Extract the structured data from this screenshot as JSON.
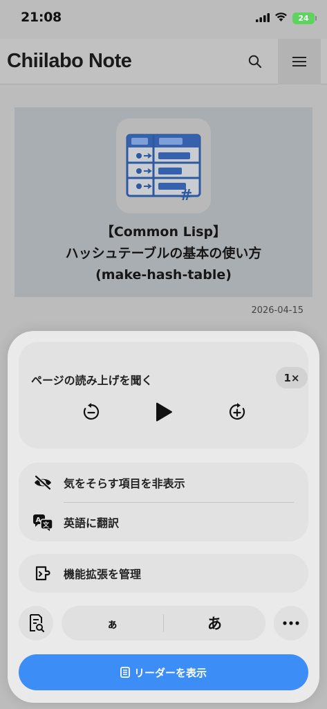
{
  "status": {
    "time": "21:08",
    "battery": "24"
  },
  "header": {
    "title": "Chiilabo Note"
  },
  "article": {
    "title_line1": "【Common Lisp】",
    "title_line2": "ハッシュテーブルの基本の使い方",
    "title_line3": "(make-hash-table)",
    "date": "2026-04-15"
  },
  "sheet": {
    "listen_title": "ページの読み上げを聞く",
    "speed": "1×",
    "hide_distractions": "気をそらす項目を非表示",
    "translate": "英語に翻訳",
    "manage_extensions": "機能拡張を管理",
    "font_small": "ぁ",
    "font_large": "あ",
    "reader_label": "リーダーを表示"
  },
  "colors": {
    "accent": "#3c8df5",
    "battery": "#5fd35f"
  }
}
